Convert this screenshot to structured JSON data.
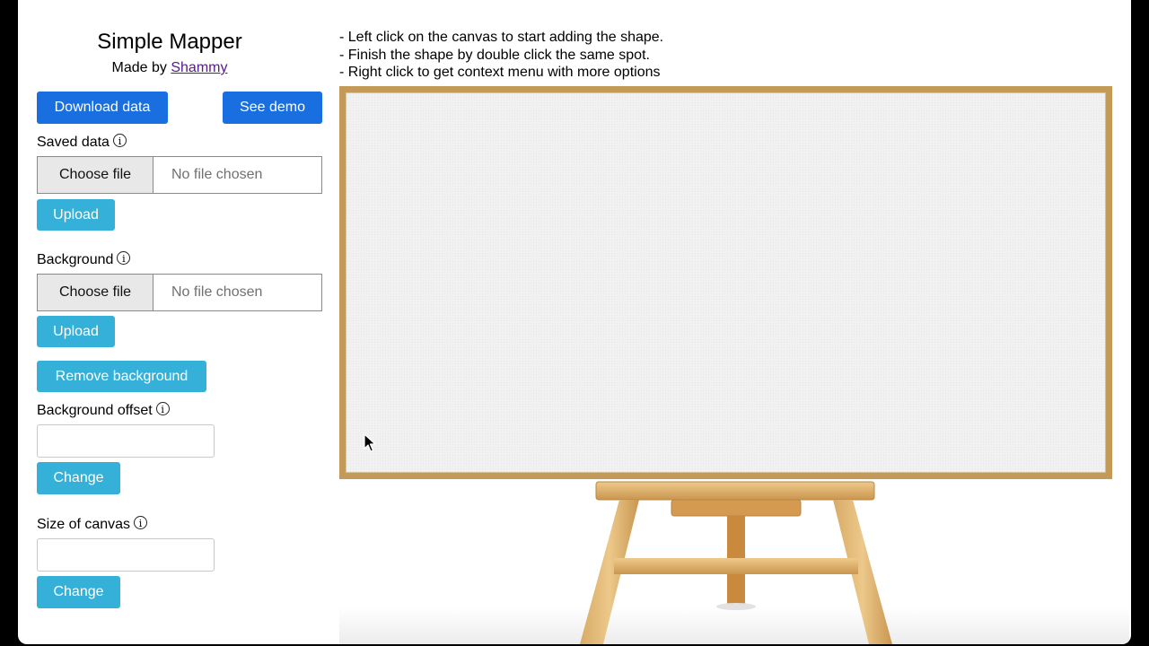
{
  "app": {
    "title": "Simple Mapper",
    "byline_prefix": "Made by",
    "author_link": "Shammy"
  },
  "toolbar": {
    "download_label": "Download data",
    "demo_label": "See demo"
  },
  "saved_data": {
    "label": "Saved data",
    "choose_label": "Choose file",
    "status": "No file chosen",
    "upload_label": "Upload"
  },
  "background": {
    "label": "Background",
    "choose_label": "Choose file",
    "status": "No file chosen",
    "upload_label": "Upload",
    "remove_label": "Remove background"
  },
  "offset": {
    "label": "Background offset",
    "value": "",
    "change_label": "Change"
  },
  "canvas_size": {
    "label": "Size of canvas",
    "value": "",
    "change_label": "Change"
  },
  "instructions": [
    "- Left click on the canvas to start adding the shape.",
    "- Finish the shape by double click the same spot.",
    "- Right click to get context menu with more options"
  ],
  "icons": {
    "info": "info-circle-icon",
    "cursor": "mouse-pointer-icon"
  },
  "colors": {
    "primary_button": "#1a6fe0",
    "info_button": "#35b0d9",
    "easel_frame": "#c49a58",
    "link": "#551a8b"
  }
}
